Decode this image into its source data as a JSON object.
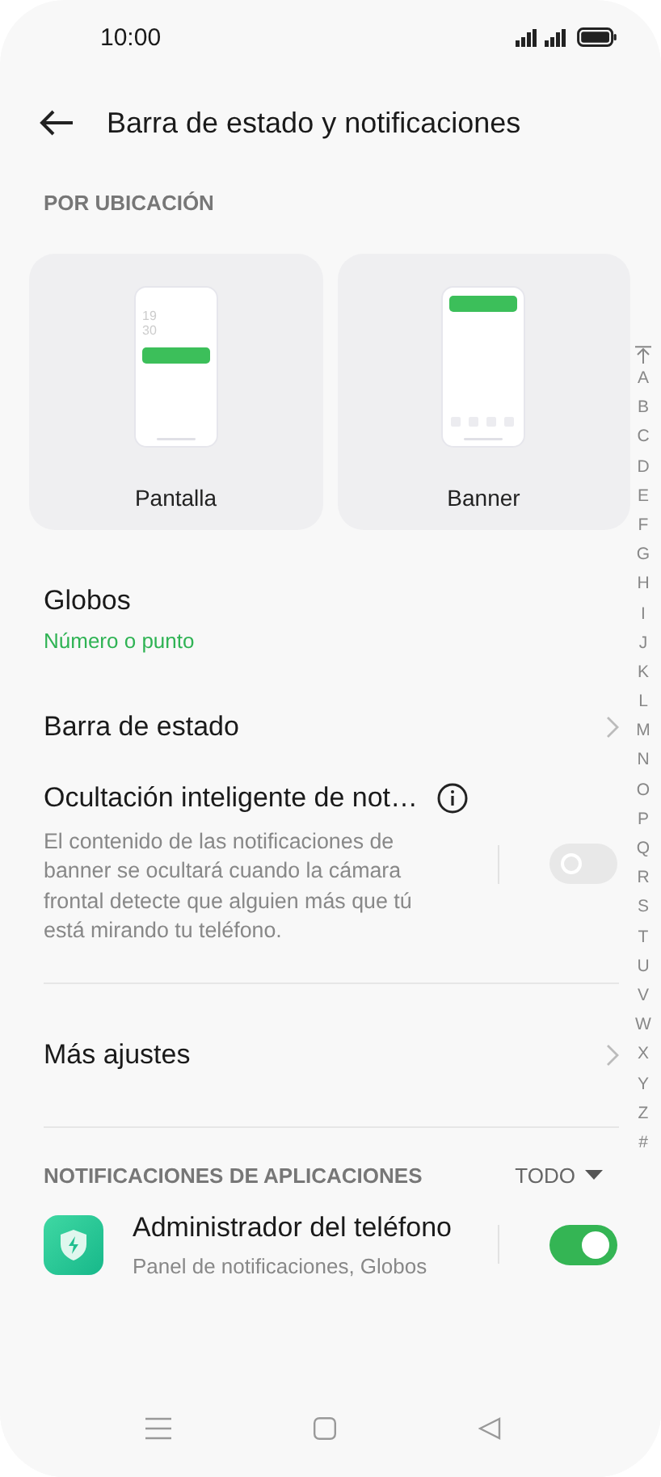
{
  "status_bar": {
    "time": "10:00"
  },
  "header": {
    "title": "Barra de estado y notificaciones"
  },
  "location_section": {
    "label": "POR UBICACIÓN",
    "options": [
      {
        "kind": "lockscreen",
        "label": "Pantalla",
        "clock": [
          "19",
          "30"
        ]
      },
      {
        "kind": "banner",
        "label": "Banner"
      }
    ]
  },
  "settings": [
    {
      "kind": "value",
      "title": "Globos",
      "value": "Número o punto"
    },
    {
      "kind": "link",
      "title": "Barra de estado"
    },
    {
      "kind": "toggle",
      "title": "Ocultación inteligente de not…",
      "description": "El contenido de las notificaciones de banner se ocultará cuando la cámara frontal detecte que alguien más que tú está mirando tu teléfono.",
      "on": false
    },
    {
      "kind": "divider"
    },
    {
      "kind": "link",
      "title": "Más ajustes"
    },
    {
      "kind": "divider"
    }
  ],
  "app_notifications": {
    "label": "NOTIFICACIONES DE APLICACIONES",
    "filter": "TODO",
    "apps": [
      {
        "name": "Administrador del teléfono",
        "detail": "Panel de notificaciones, Globos",
        "on": true
      }
    ]
  },
  "index_bar": {
    "letters": [
      "A",
      "B",
      "C",
      "D",
      "E",
      "F",
      "G",
      "H",
      "I",
      "J",
      "K",
      "L",
      "M",
      "N",
      "O",
      "P",
      "Q",
      "R",
      "S",
      "T",
      "U",
      "V",
      "W",
      "X",
      "Y",
      "Z",
      "#"
    ]
  }
}
